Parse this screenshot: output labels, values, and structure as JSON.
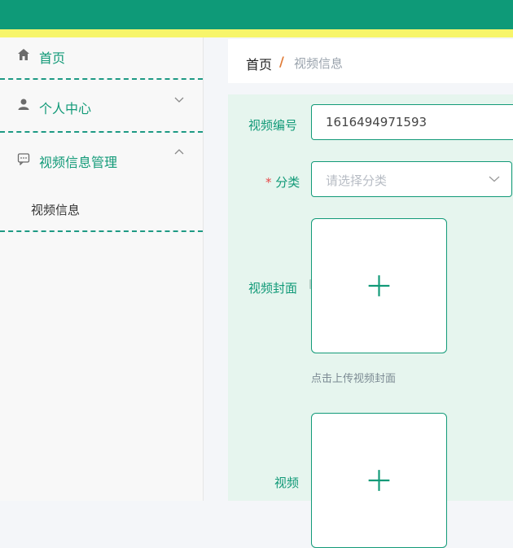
{
  "sidebar": {
    "items": [
      {
        "label": "首页",
        "icon": "home-icon"
      },
      {
        "label": "个人中心",
        "icon": "user-icon",
        "expanded": false
      },
      {
        "label": "视频信息管理",
        "icon": "chat-icon",
        "expanded": true,
        "children": [
          {
            "label": "视频信息"
          }
        ]
      }
    ]
  },
  "breadcrumb": {
    "home": "首页",
    "separator": "/",
    "current": "视频信息"
  },
  "form": {
    "video_no_label": "视频编号",
    "video_no_value": "1616494971593",
    "category_label": "分类",
    "required_mark": "*",
    "category_placeholder": "请选择分类",
    "cover_label": "视频封面",
    "cover_hint": "点击上传视频封面",
    "video_label": "视频"
  },
  "colors": {
    "accent": "#129a78",
    "topbar": "#0e9a78",
    "topline": "#f7f56a",
    "panel": "#e6f5ee"
  }
}
